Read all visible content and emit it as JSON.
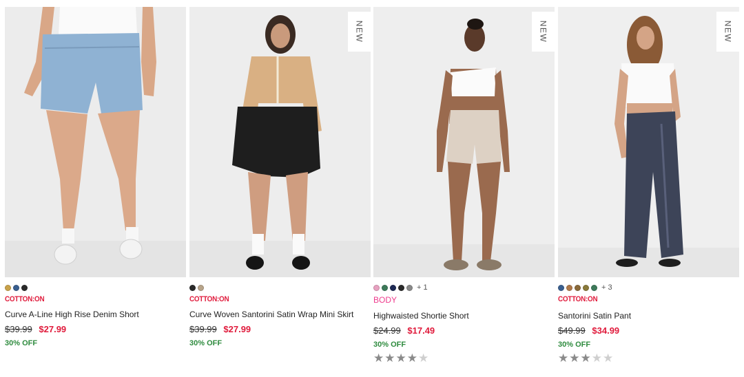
{
  "products": [
    {
      "brand": "COTTON:ON",
      "name": "Curve A-Line High Rise Denim Short",
      "was_price": "$39.99",
      "now_price": "$27.99",
      "discount": "30% OFF",
      "new_badge": "",
      "swatches": [
        "#c9a24a",
        "#3a5f8f",
        "#2a2a2a"
      ],
      "more_colors": "",
      "rating": null,
      "image_icon": "woman-denim-shorts-photo"
    },
    {
      "brand": "COTTON:ON",
      "name": "Curve Woven Santorini Satin Wrap Mini Skirt",
      "was_price": "$39.99",
      "now_price": "$27.99",
      "discount": "30% OFF",
      "new_badge": "NEW",
      "swatches": [
        "#2a2a2a",
        "#b8a48a"
      ],
      "more_colors": "",
      "rating": null,
      "image_icon": "woman-mini-skirt-photo"
    },
    {
      "brand": "BODY",
      "name": "Highwaisted Shortie Short",
      "was_price": "$24.99",
      "now_price": "$17.49",
      "discount": "30% OFF",
      "new_badge": "NEW",
      "swatches": [
        "#e7a1c0",
        "#3d7a5a",
        "#1e2a55",
        "#2a2a2a",
        "#8a8a8a"
      ],
      "more_colors": "+ 1",
      "rating": 4,
      "image_icon": "woman-bike-shorts-photo"
    },
    {
      "brand": "COTTON:ON",
      "name": "Santorini Satin Pant",
      "was_price": "$49.99",
      "now_price": "$34.99",
      "discount": "30% OFF",
      "new_badge": "NEW",
      "swatches": [
        "#3a5f8f",
        "#b07a4a",
        "#8a6a3a",
        "#8a7a3a",
        "#3d7a5a"
      ],
      "more_colors": "+ 3",
      "rating": 3,
      "image_icon": "woman-satin-pant-photo"
    }
  ],
  "colors": {
    "brand_red": "#e01b3c",
    "body_pink": "#ee3a8c",
    "discount_green": "#2e8b3e",
    "image_bg": "#efefef"
  }
}
